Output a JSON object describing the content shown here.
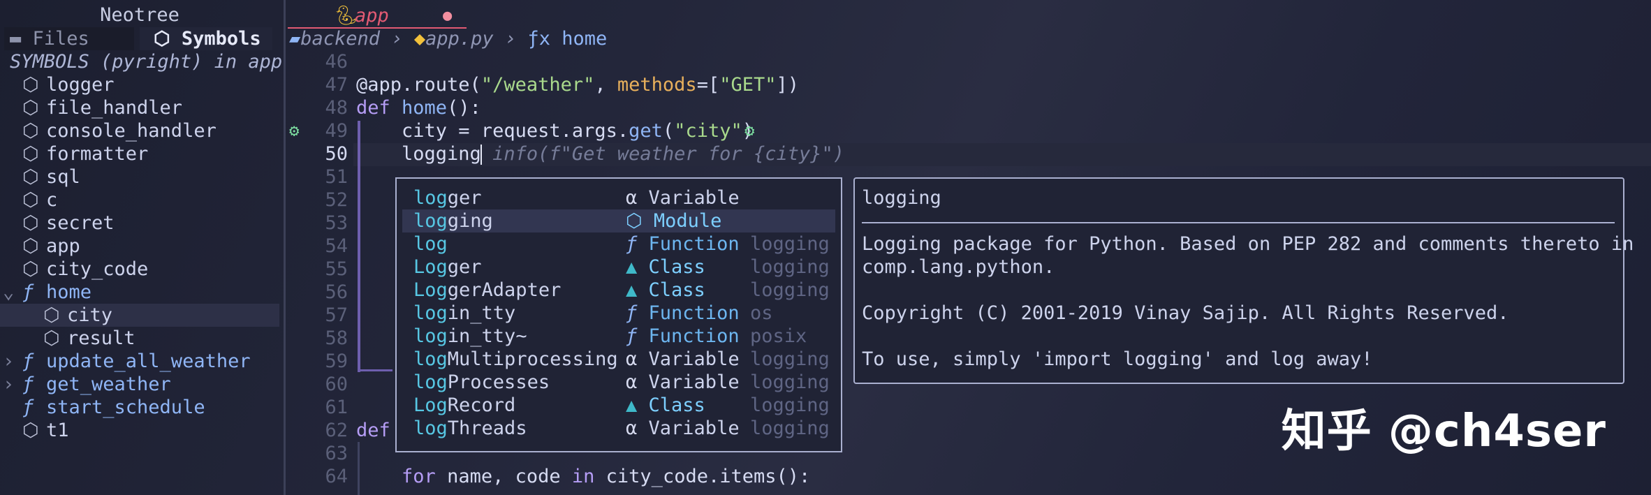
{
  "sidebar": {
    "title": "Neotree",
    "tabs": {
      "files": "Files",
      "symbols": "Symbols"
    },
    "header": "SYMBOLS (pyright) in app",
    "items": [
      {
        "label": "logger",
        "kind": "variable"
      },
      {
        "label": "file_handler",
        "kind": "variable"
      },
      {
        "label": "console_handler",
        "kind": "variable"
      },
      {
        "label": "formatter",
        "kind": "variable"
      },
      {
        "label": "sql",
        "kind": "variable"
      },
      {
        "label": "c",
        "kind": "variable"
      },
      {
        "label": "secret",
        "kind": "variable"
      },
      {
        "label": "app",
        "kind": "variable"
      },
      {
        "label": "city_code",
        "kind": "variable"
      },
      {
        "label": "home",
        "kind": "function",
        "expanded": true
      },
      {
        "label": "city",
        "kind": "variable",
        "selected": true
      },
      {
        "label": "result",
        "kind": "variable"
      },
      {
        "label": "update_all_weather",
        "kind": "function",
        "expanded": false
      },
      {
        "label": "get_weather",
        "kind": "function",
        "expanded": false
      },
      {
        "label": "start_schedule",
        "kind": "function"
      },
      {
        "label": "t1",
        "kind": "variable"
      }
    ]
  },
  "editor": {
    "buffer_tab": "app",
    "modified_indicator": "●",
    "breadcrumb": {
      "folder": "backend",
      "file": "app.py",
      "symbol": "home",
      "sep": "›",
      "fn_glyph": "ƒx"
    },
    "line_numbers": [
      "46",
      "47",
      "48",
      "49",
      "50",
      "51",
      "52",
      "53",
      "54",
      "55",
      "56",
      "57",
      "58",
      "59",
      "60",
      "61",
      "62",
      "63",
      "64"
    ],
    "current_line": "50",
    "lines": {
      "l47": {
        "deco": "@app.route(",
        "str": "\"/weather\"",
        "sep": ", ",
        "arg": "methods",
        "eq": "=[",
        "str2": "\"GET\"",
        "end": "])"
      },
      "l48": {
        "kw": "def ",
        "fn": "home",
        "end": "():"
      },
      "l49": {
        "pre": "    city = request.args.",
        "fn": "get",
        "open": "(",
        "str": "\"city\"",
        "end": ")"
      },
      "l50": {
        "typed": "    logging",
        "ghost": " info(f\"Get weather for {city}\")"
      },
      "l62": {
        "kw": "def"
      },
      "l64": {
        "kw1": "for",
        "mid": " name, code ",
        "kw2": "in",
        "end": " city_code.items():"
      }
    }
  },
  "completion": {
    "items": [
      {
        "match": "log",
        "rest": "ger",
        "kind": "Variable",
        "glyph": "α",
        "source": ""
      },
      {
        "match": "log",
        "rest": "ging",
        "kind": "Module",
        "glyph": "⬡",
        "source": "",
        "selected": true
      },
      {
        "match": "log",
        "rest": "",
        "kind": "Function",
        "glyph": "ƒ",
        "source": "logging"
      },
      {
        "match": "Log",
        "rest": "ger",
        "kind": "Class",
        "glyph": "▲",
        "source": "logging"
      },
      {
        "match": "Log",
        "rest": "gerAdapter",
        "kind": "Class",
        "glyph": "▲",
        "source": "logging"
      },
      {
        "match": "log",
        "rest": "in_tty",
        "kind": "Function",
        "glyph": "ƒ",
        "source": "os"
      },
      {
        "match": "log",
        "rest": "in_tty~",
        "kind": "Function",
        "glyph": "ƒ",
        "source": "posix"
      },
      {
        "match": "log",
        "rest": "Multiprocessing",
        "kind": "Variable",
        "glyph": "α",
        "source": "logging"
      },
      {
        "match": "log",
        "rest": "Processes",
        "kind": "Variable",
        "glyph": "α",
        "source": "logging"
      },
      {
        "match": "Log",
        "rest": "Record",
        "kind": "Class",
        "glyph": "▲",
        "source": "logging"
      },
      {
        "match": "log",
        "rest": "Threads",
        "kind": "Variable",
        "glyph": "α",
        "source": "logging"
      }
    ]
  },
  "documentation": {
    "title": "logging",
    "lines": [
      "Logging package for Python. Based on PEP 282 and comments thereto in",
      "comp.lang.python.",
      "",
      "Copyright (C) 2001-2019 Vinay Sajip. All Rights Reserved.",
      "",
      "To use, simply 'import logging' and log away!"
    ]
  },
  "watermark": "知乎 @ch4ser"
}
